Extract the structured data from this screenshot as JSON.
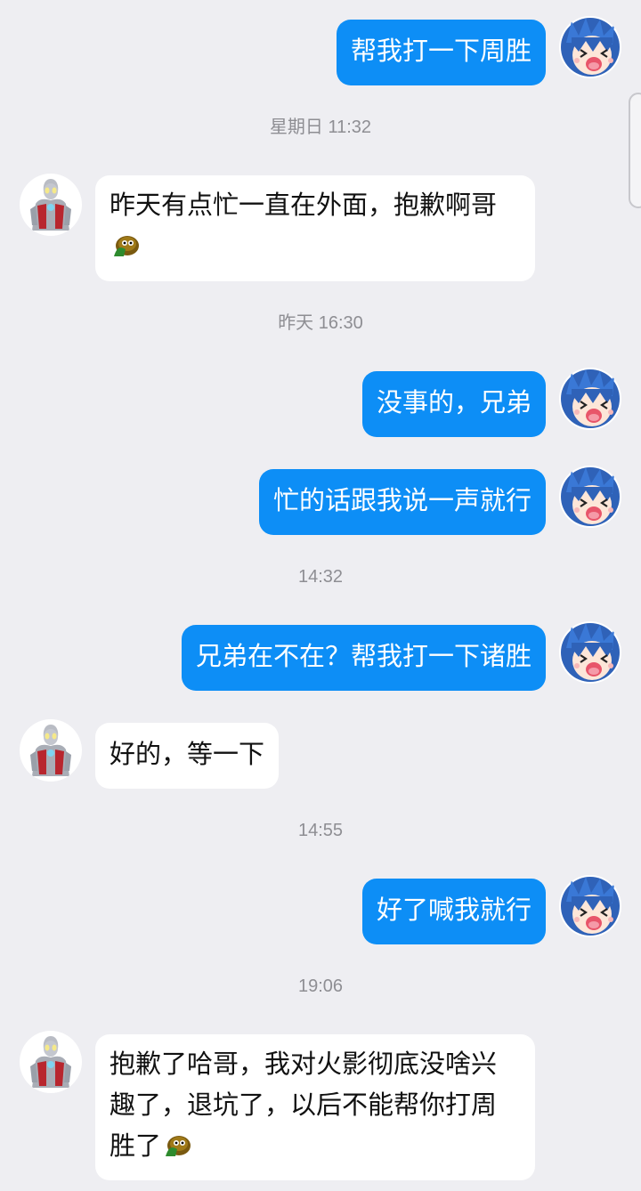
{
  "messages": [
    {
      "side": "out",
      "text": "帮我打一下周胜"
    },
    {
      "side": "in",
      "text": "昨天有点忙一直在外面，抱歉啊哥",
      "emoji": "turtle-emoji"
    },
    {
      "side": "out",
      "text": "没事的，兄弟"
    },
    {
      "side": "out",
      "text": "忙的话跟我说一声就行"
    },
    {
      "side": "out",
      "text": "兄弟在不在？帮我打一下诸胜"
    },
    {
      "side": "in",
      "text": "好的，等一下"
    },
    {
      "side": "out",
      "text": "好了喊我就行"
    },
    {
      "side": "in",
      "text": "抱歉了哈哥，我对火影彻底没啥兴趣了，退坑了，以后不能帮你打周胜了",
      "emoji": "turtle-emoji"
    }
  ],
  "timestamps": [
    "星期日 11:32",
    "昨天 16:30",
    "14:32",
    "14:55",
    "19:06"
  ],
  "avatars": {
    "self": "anime-girl-avatar",
    "contact": "ultraman-avatar"
  },
  "colors": {
    "background": "#eeeef2",
    "outgoing_bubble": "#0d8ef6",
    "incoming_bubble": "#ffffff",
    "timestamp": "#8e8e93"
  }
}
